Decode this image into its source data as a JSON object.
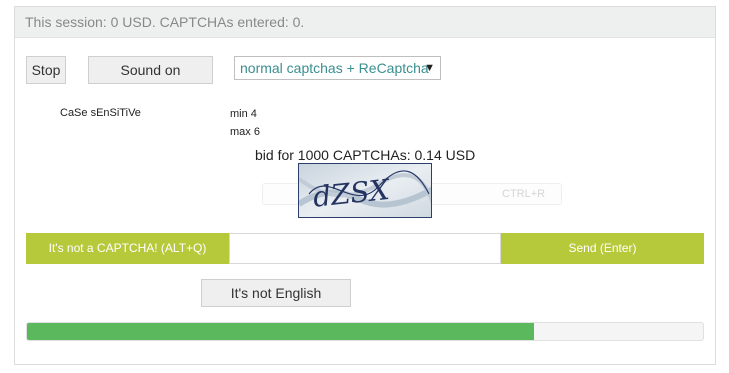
{
  "session": {
    "text": "This session: 0 USD. CAPTCHAs entered: 0."
  },
  "controls": {
    "stop_label": "Stop",
    "sound_label": "Sound on",
    "mode_selected": "normal captchas + ReCaptcha",
    "mode_arrow": "▼"
  },
  "captcha": {
    "case_label": "CaSe sEnSiTiVe",
    "min_label": "min 4",
    "max_label": "max 6",
    "bid_label": "bid for 1000 CAPTCHAs: 0.14 USD",
    "hint": "CTRL+R",
    "image_text": "dZSX"
  },
  "actions": {
    "not_captcha_label": "It's not a CAPTCHA! (ALT+Q)",
    "answer_value": "",
    "send_label": "Send (Enter)",
    "not_english_label": "It's not English"
  },
  "progress": {
    "fraction": 0.75
  },
  "colors": {
    "accent": "#b6c93a",
    "progress": "#5cb85c",
    "select_text": "#3a8f8f"
  },
  "icons": {
    "dropdown": "dropdown-arrow-icon"
  }
}
